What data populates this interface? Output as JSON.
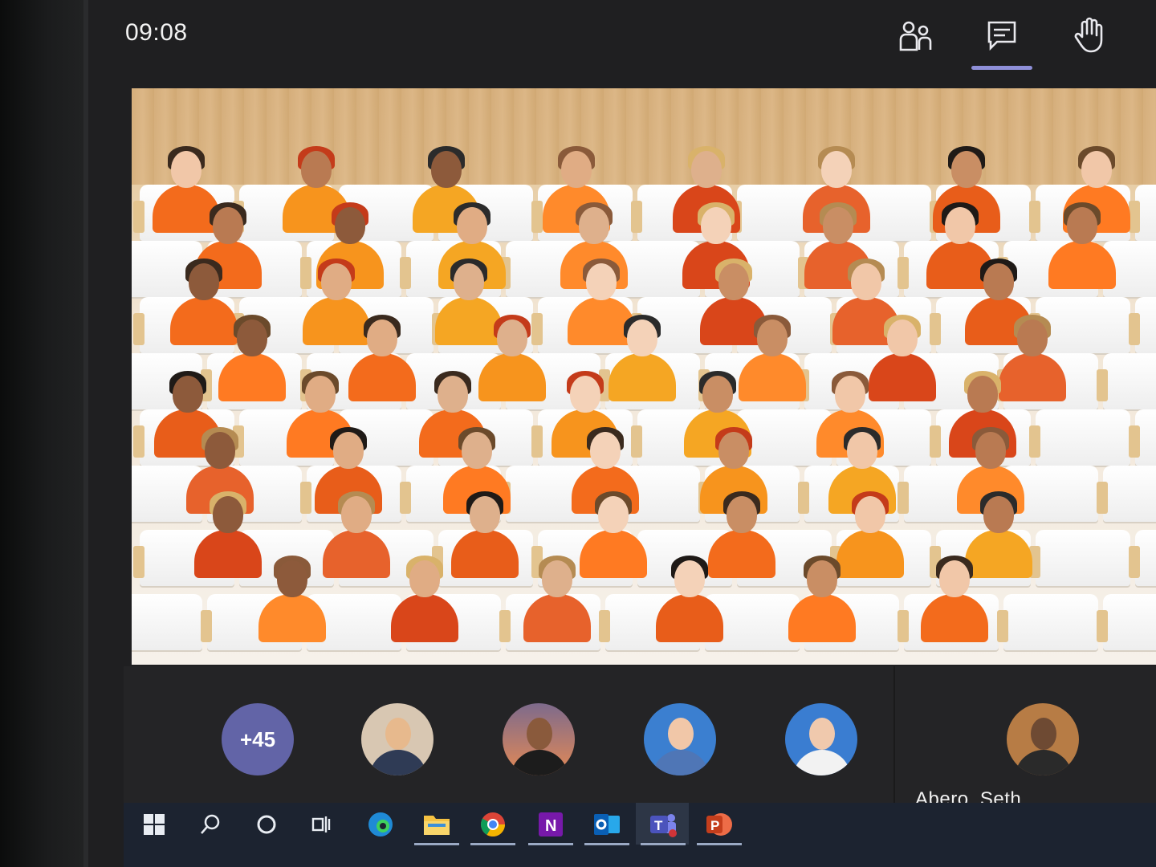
{
  "top_bar": {
    "clock": "09:08",
    "icons": [
      "people-icon",
      "chat-icon",
      "raise-hand-icon"
    ]
  },
  "stage": {
    "mode": "together-mode",
    "participant_count_visible": 50
  },
  "participant_strip": {
    "overflow_count": "+45",
    "avatars": [
      "avatar-1",
      "avatar-2",
      "avatar-3",
      "avatar-4"
    ],
    "self_name": "Abero, Seth"
  },
  "taskbar": {
    "items": [
      "windows-start-icon",
      "search-icon",
      "cortana-icon",
      "task-view-icon",
      "edge-icon",
      "file-explorer-icon",
      "chrome-icon",
      "onenote-icon",
      "outlook-icon",
      "teams-icon",
      "powerpoint-icon"
    ]
  },
  "colors": {
    "accent": "#6264a7",
    "orange_shirt": "#f36b1c",
    "background": "#1f1f21"
  }
}
